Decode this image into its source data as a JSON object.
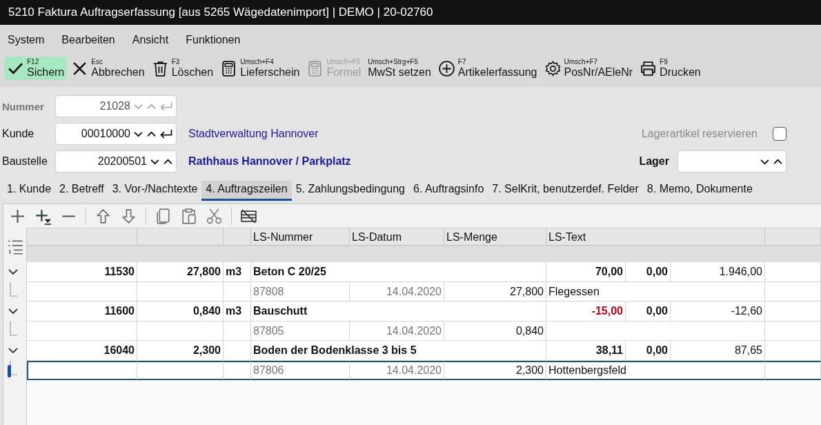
{
  "window": {
    "title": "5210 Faktura Auftragserfassung [aus 5265 Wägedatenimport] | DEMO | 20-02760"
  },
  "menu": [
    "System",
    "Bearbeiten",
    "Ansicht",
    "Funktionen"
  ],
  "toolbar": [
    {
      "kind": "check",
      "shortcut": "F12",
      "label": "Sichern",
      "selected": true,
      "disabled": false
    },
    {
      "kind": "cross",
      "shortcut": "Esc",
      "label": "Abbrechen",
      "selected": false,
      "disabled": false
    },
    {
      "kind": "trash",
      "shortcut": "F3",
      "label": "Löschen",
      "selected": false,
      "disabled": false
    },
    {
      "kind": "calculator",
      "shortcut": "Umsch+F4",
      "label": "Lieferschein",
      "selected": false,
      "disabled": false
    },
    {
      "kind": "calculator",
      "shortcut": "Umsch+F5",
      "label": "Formel",
      "selected": false,
      "disabled": true
    },
    {
      "kind": "plain",
      "shortcut": "Umsch+Strg+F5",
      "label": "MwSt setzen",
      "selected": false,
      "disabled": false
    },
    {
      "kind": "plus-circle",
      "shortcut": "F7",
      "label": "Artikelerfassung",
      "selected": false,
      "disabled": false
    },
    {
      "kind": "gear",
      "shortcut": "Umsch+F7",
      "label": "PosNr/AEleNr",
      "selected": false,
      "disabled": false
    },
    {
      "kind": "printer",
      "shortcut": "F9",
      "label": "Drucken",
      "selected": false,
      "disabled": false
    }
  ],
  "form": {
    "fields": [
      {
        "label": "Nummer",
        "value": "21028",
        "disabled": true,
        "enter_button": true
      },
      {
        "label": "Kunde",
        "value": "00010000",
        "disabled": false,
        "enter_button": true,
        "name": "Stadtverwaltung Hannover",
        "name_bold": false
      },
      {
        "label": "Baustelle",
        "value": "20200501",
        "disabled": false,
        "enter_button": false,
        "name": "Rathhaus Hannover / Parkplatz",
        "name_bold": true
      }
    ],
    "reserve": {
      "label": "Lagerartikel reservieren",
      "checked": false,
      "disabled": true
    },
    "lager": {
      "label": "Lager"
    }
  },
  "tabs": [
    {
      "label": "1. Kunde",
      "selected": false
    },
    {
      "label": "2. Betreff",
      "selected": false
    },
    {
      "label": "3. Vor-/Nachtexte",
      "selected": false
    },
    {
      "label": "4. Auftragszeilen",
      "selected": true
    },
    {
      "label": "5. Zahlungsbedingung",
      "selected": false
    },
    {
      "label": "6. Auftragsinfo",
      "selected": false
    },
    {
      "label": "7. SelKrit, benutzerdef. Felder",
      "selected": false
    },
    {
      "label": "8. Memo, Dokumente",
      "selected": false
    }
  ],
  "grid": {
    "columns": [
      "LS-Nummer",
      "LS-Datum",
      "LS-Menge",
      "LS-Text"
    ],
    "rows": [
      {
        "expanded": true,
        "nr": "11530",
        "quantity": "27,800",
        "unit": "m3",
        "text": "Beton C 20/25",
        "price": "70,00",
        "price_alert": false,
        "discount": "0,00",
        "total": "1.946,00",
        "delivery": {
          "ls_nummer": "87808",
          "ls_datum": "14.04.2020",
          "ls_menge": "27,800",
          "ls_text": "Flegessen",
          "selected": false
        }
      },
      {
        "expanded": true,
        "nr": "11600",
        "quantity": "0,840",
        "unit": "m3",
        "text": "Bauschutt",
        "price": "-15,00",
        "price_alert": true,
        "discount": "0,00",
        "total": "-12,60",
        "delivery": {
          "ls_nummer": "87805",
          "ls_datum": "14.04.2020",
          "ls_menge": "0,840",
          "selected": false
        }
      },
      {
        "expanded": true,
        "nr": "16040",
        "quantity": "2,300",
        "text": "Boden der Bodenklasse 3 bis 5",
        "price": "38,11",
        "price_alert": false,
        "discount": "0,00",
        "total": "87,65",
        "delivery": {
          "ls_nummer": "87806",
          "ls_datum": "14.04.2020",
          "ls_menge": "2,300",
          "ls_text": "Hottenbergsfeld",
          "selected": true
        }
      }
    ]
  }
}
